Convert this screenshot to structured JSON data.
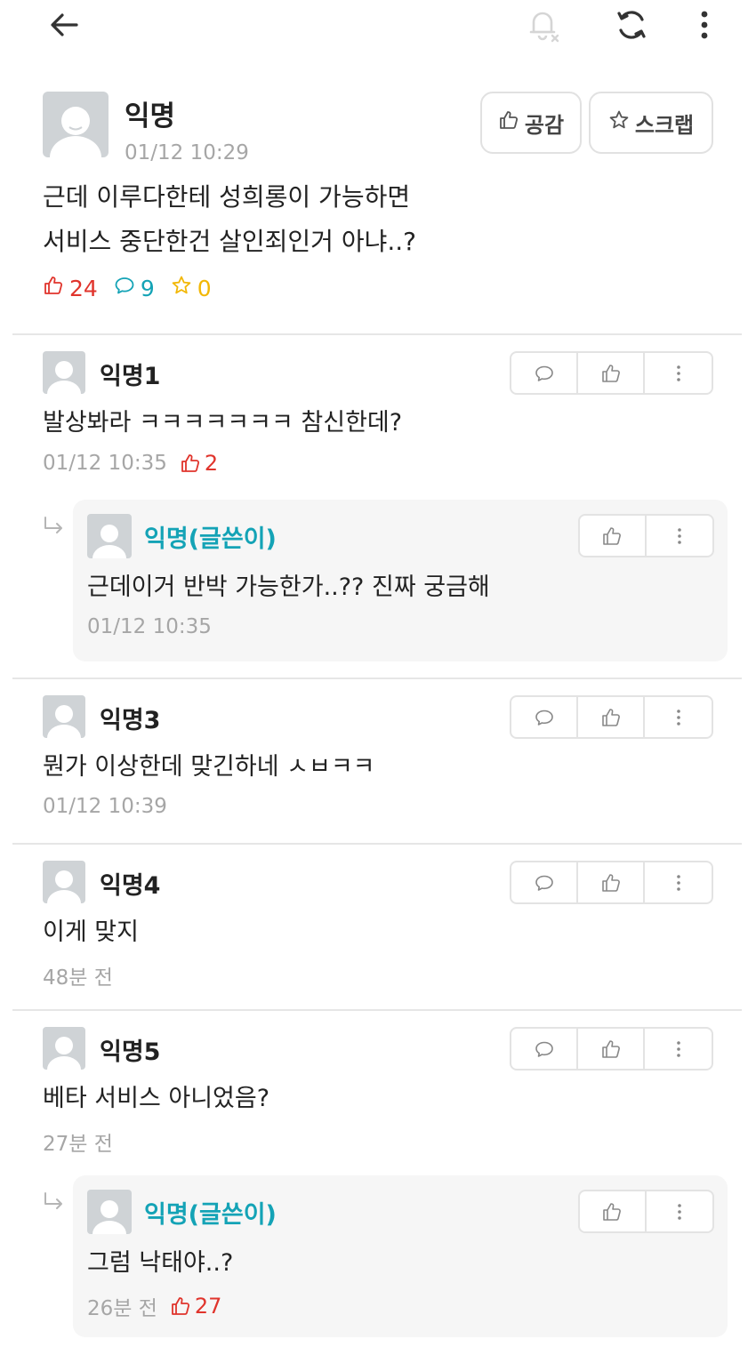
{
  "colors": {
    "accent_red": "#e0342c",
    "accent_teal": "#14a3b6",
    "accent_yellow": "#f2b705",
    "muted": "#a6a6a6"
  },
  "topbar": {
    "icons": [
      "back-arrow-icon",
      "notification-off-icon",
      "refresh-icon",
      "more-vertical-icon"
    ]
  },
  "post": {
    "author": "익명",
    "time": "01/12 10:29",
    "like_label": "공감",
    "scrap_label": "스크랩",
    "body_line1": "근데 이루다한테 성희롱이 가능하면",
    "body_line2": "서비스 중단한건 살인죄인거 아냐..?",
    "likes": "24",
    "comments": "9",
    "scraps": "0"
  },
  "comments": [
    {
      "author": "익명1",
      "text": "발상봐라 ㅋㅋㅋㅋㅋㅋㅋ 참신한데?",
      "time": "01/12 10:35",
      "votes": "2",
      "reply": {
        "author": "익명(글쓴이)",
        "text": "근데이거 반박 가능한가..?? 진짜 궁금해",
        "time": "01/12 10:35"
      }
    },
    {
      "author": "익명3",
      "text": "뭔가 이상한데 맞긴하네 ㅅㅂㅋㅋ",
      "time": "01/12 10:39"
    },
    {
      "author": "익명4",
      "text": "이게 맞지",
      "time": "48분 전"
    },
    {
      "author": "익명5",
      "text": "베타 서비스 아니었음?",
      "time": "27분 전",
      "reply": {
        "author": "익명(글쓴이)",
        "text": "그럼 낙태야..?",
        "time": "26분 전",
        "votes": "27"
      }
    }
  ]
}
